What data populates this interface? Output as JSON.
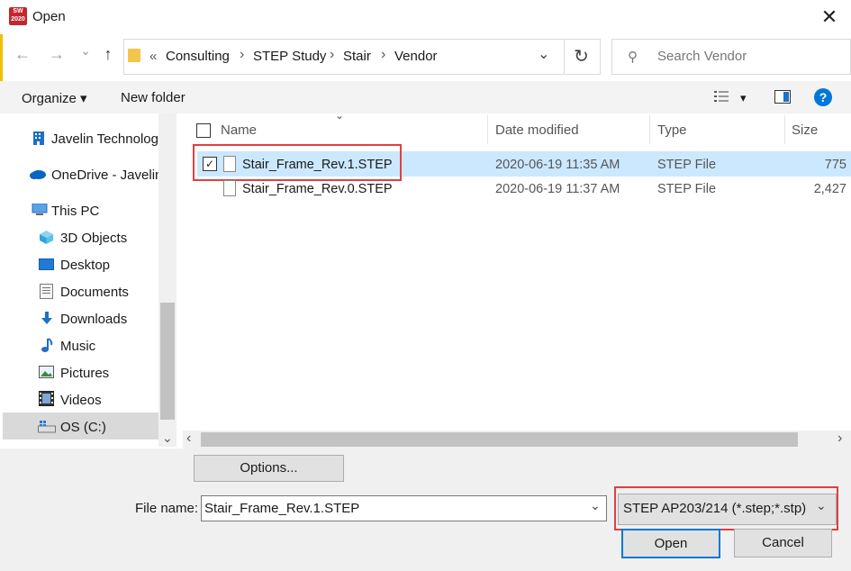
{
  "window": {
    "title": "Open",
    "app_badge": "SW 2020",
    "close_glyph": "✕"
  },
  "nav_buttons": {
    "back": "←",
    "forward": "→",
    "recent": "⌄",
    "up": "↑"
  },
  "address": {
    "overflow": "«",
    "crumbs": [
      "Consulting",
      "STEP Study",
      "Stair",
      "Vendor"
    ],
    "separator": "›",
    "dropdown": "⌄",
    "refresh": "↻"
  },
  "search": {
    "placeholder": "Search Vendor"
  },
  "toolbar": {
    "organize": "Organize ▾",
    "new_folder": "New folder",
    "view_dd": "▾",
    "help": "?"
  },
  "sidebar": {
    "items": [
      {
        "label": "Javelin Technologi",
        "icon": "building-icon"
      },
      {
        "label": "OneDrive - Javelin",
        "icon": "cloud-icon"
      },
      {
        "label": "This PC",
        "icon": "pc-icon"
      },
      {
        "label": "3D Objects",
        "icon": "cube-icon"
      },
      {
        "label": "Desktop",
        "icon": "desktop-icon"
      },
      {
        "label": "Documents",
        "icon": "documents-icon"
      },
      {
        "label": "Downloads",
        "icon": "downloads-icon"
      },
      {
        "label": "Music",
        "icon": "music-icon"
      },
      {
        "label": "Pictures",
        "icon": "pictures-icon"
      },
      {
        "label": "Videos",
        "icon": "videos-icon"
      },
      {
        "label": "OS (C:)",
        "icon": "drive-icon"
      }
    ],
    "selected": "OS (C:)",
    "scroll_down": "⌄"
  },
  "file_list": {
    "columns": [
      "Name",
      "Date modified",
      "Type",
      "Size"
    ],
    "sort_indicator": "⌄",
    "rows": [
      {
        "name": "Stair_Frame_Rev.1.STEP",
        "date": "2020-06-19 11:35 AM",
        "type": "STEP File",
        "size": "775",
        "selected": true
      },
      {
        "name": "Stair_Frame_Rev.0.STEP",
        "date": "2020-06-19 11:37 AM",
        "type": "STEP File",
        "size": "2,427",
        "selected": false
      }
    ],
    "scroll_left": "‹",
    "scroll_right": "›"
  },
  "options_button": "Options...",
  "filename": {
    "label": "File name:",
    "value": "Stair_Frame_Rev.1.STEP",
    "dropdown": "⌄"
  },
  "filetype": {
    "value": "STEP AP203/214 (*.step;*.stp)",
    "dropdown": "⌄"
  },
  "buttons": {
    "open": "Open",
    "cancel": "Cancel"
  },
  "colors": {
    "selection": "#cce8ff",
    "highlight_box": "#e04040",
    "accent": "#0078d7"
  }
}
